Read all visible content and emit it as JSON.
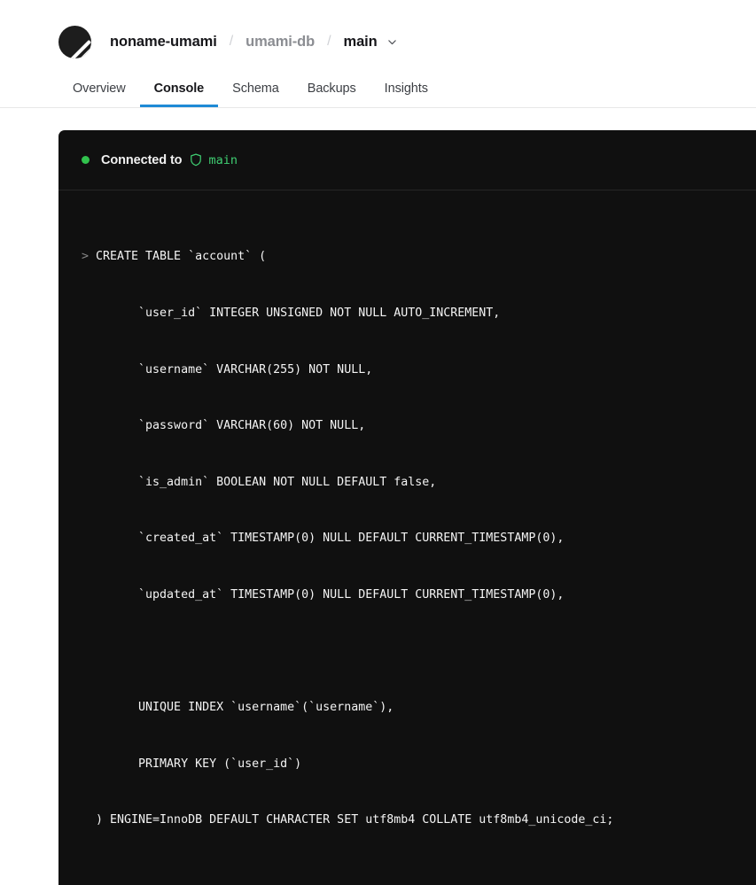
{
  "header": {
    "breadcrumb": {
      "logo_icon": "planetscale-logo-icon",
      "organization": "noname-umami",
      "separator": "/",
      "database": "umami-db",
      "branch": "main",
      "branch_chevron_icon": "chevron-down-icon"
    },
    "tabs": [
      {
        "label": "Overview",
        "active": false
      },
      {
        "label": "Console",
        "active": true
      },
      {
        "label": "Schema",
        "active": false
      },
      {
        "label": "Backups",
        "active": false
      },
      {
        "label": "Insights",
        "active": false
      }
    ],
    "active_tab_underline_color": "#1e8ad6"
  },
  "console": {
    "status": {
      "dot_color": "#31c24d",
      "connected_text": "Connected to",
      "branch_icon": "shield-branch-icon",
      "branch_name": "main",
      "branch_name_color": "#3fce72"
    },
    "prompt_symbol": ">",
    "sql_lines": [
      {
        "prompt": true,
        "text": "CREATE TABLE `account` ("
      },
      {
        "prompt": false,
        "text": "      `user_id` INTEGER UNSIGNED NOT NULL AUTO_INCREMENT,"
      },
      {
        "prompt": false,
        "text": "      `username` VARCHAR(255) NOT NULL,"
      },
      {
        "prompt": false,
        "text": "      `password` VARCHAR(60) NOT NULL,"
      },
      {
        "prompt": false,
        "text": "      `is_admin` BOOLEAN NOT NULL DEFAULT false,"
      },
      {
        "prompt": false,
        "text": "      `created_at` TIMESTAMP(0) NULL DEFAULT CURRENT_TIMESTAMP(0),"
      },
      {
        "prompt": false,
        "text": "      `updated_at` TIMESTAMP(0) NULL DEFAULT CURRENT_TIMESTAMP(0),"
      },
      {
        "prompt": false,
        "text": ""
      },
      {
        "prompt": false,
        "text": "      UNIQUE INDEX `username`(`username`),"
      },
      {
        "prompt": false,
        "text": "      PRIMARY KEY (`user_id`)"
      },
      {
        "prompt": false,
        "text": ") ENGINE=InnoDB DEFAULT CHARACTER SET utf8mb4 COLLATE utf8mb4_unicode_ci;"
      }
    ],
    "background_color": "#101010",
    "text_color": "#f4f4f4"
  }
}
